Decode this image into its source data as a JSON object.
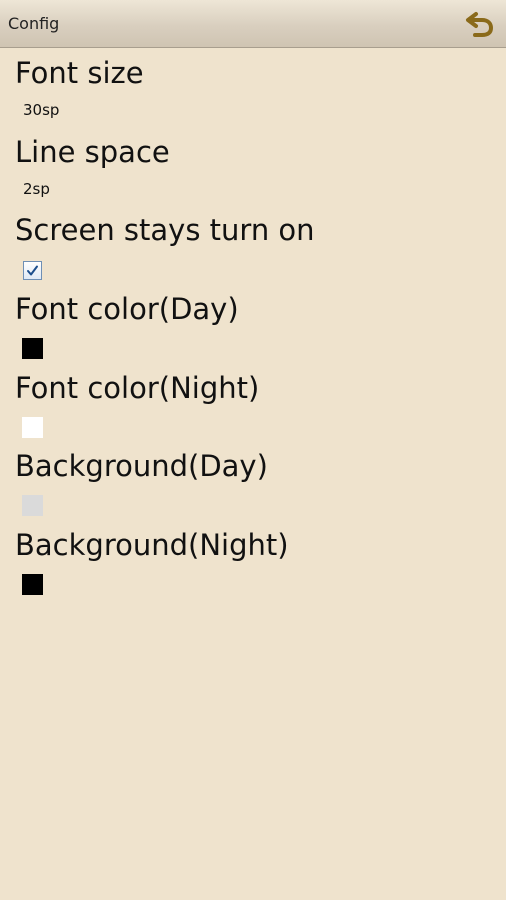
{
  "header": {
    "title": "Config",
    "back_icon": "back-arrow-icon"
  },
  "colors": {
    "background": "#efe3cd",
    "back_arrow": "#8a6a1a",
    "font_color_day": "#000000",
    "font_color_night": "#ffffff",
    "background_day": "#dadada",
    "background_night": "#000000",
    "checkbox_border": "#6e8fb5",
    "checkbox_check": "#1c4e8c"
  },
  "settings": {
    "font_size": {
      "label": "Font size",
      "value": "30sp"
    },
    "line_space": {
      "label": "Line space",
      "value": "2sp"
    },
    "screen_on": {
      "label": "Screen stays turn on",
      "checked": true
    },
    "font_color_day": {
      "label": "Font color(Day)"
    },
    "font_color_night": {
      "label": "Font color(Night)"
    },
    "background_day": {
      "label": "Background(Day)"
    },
    "background_night": {
      "label": "Background(Night)"
    }
  }
}
